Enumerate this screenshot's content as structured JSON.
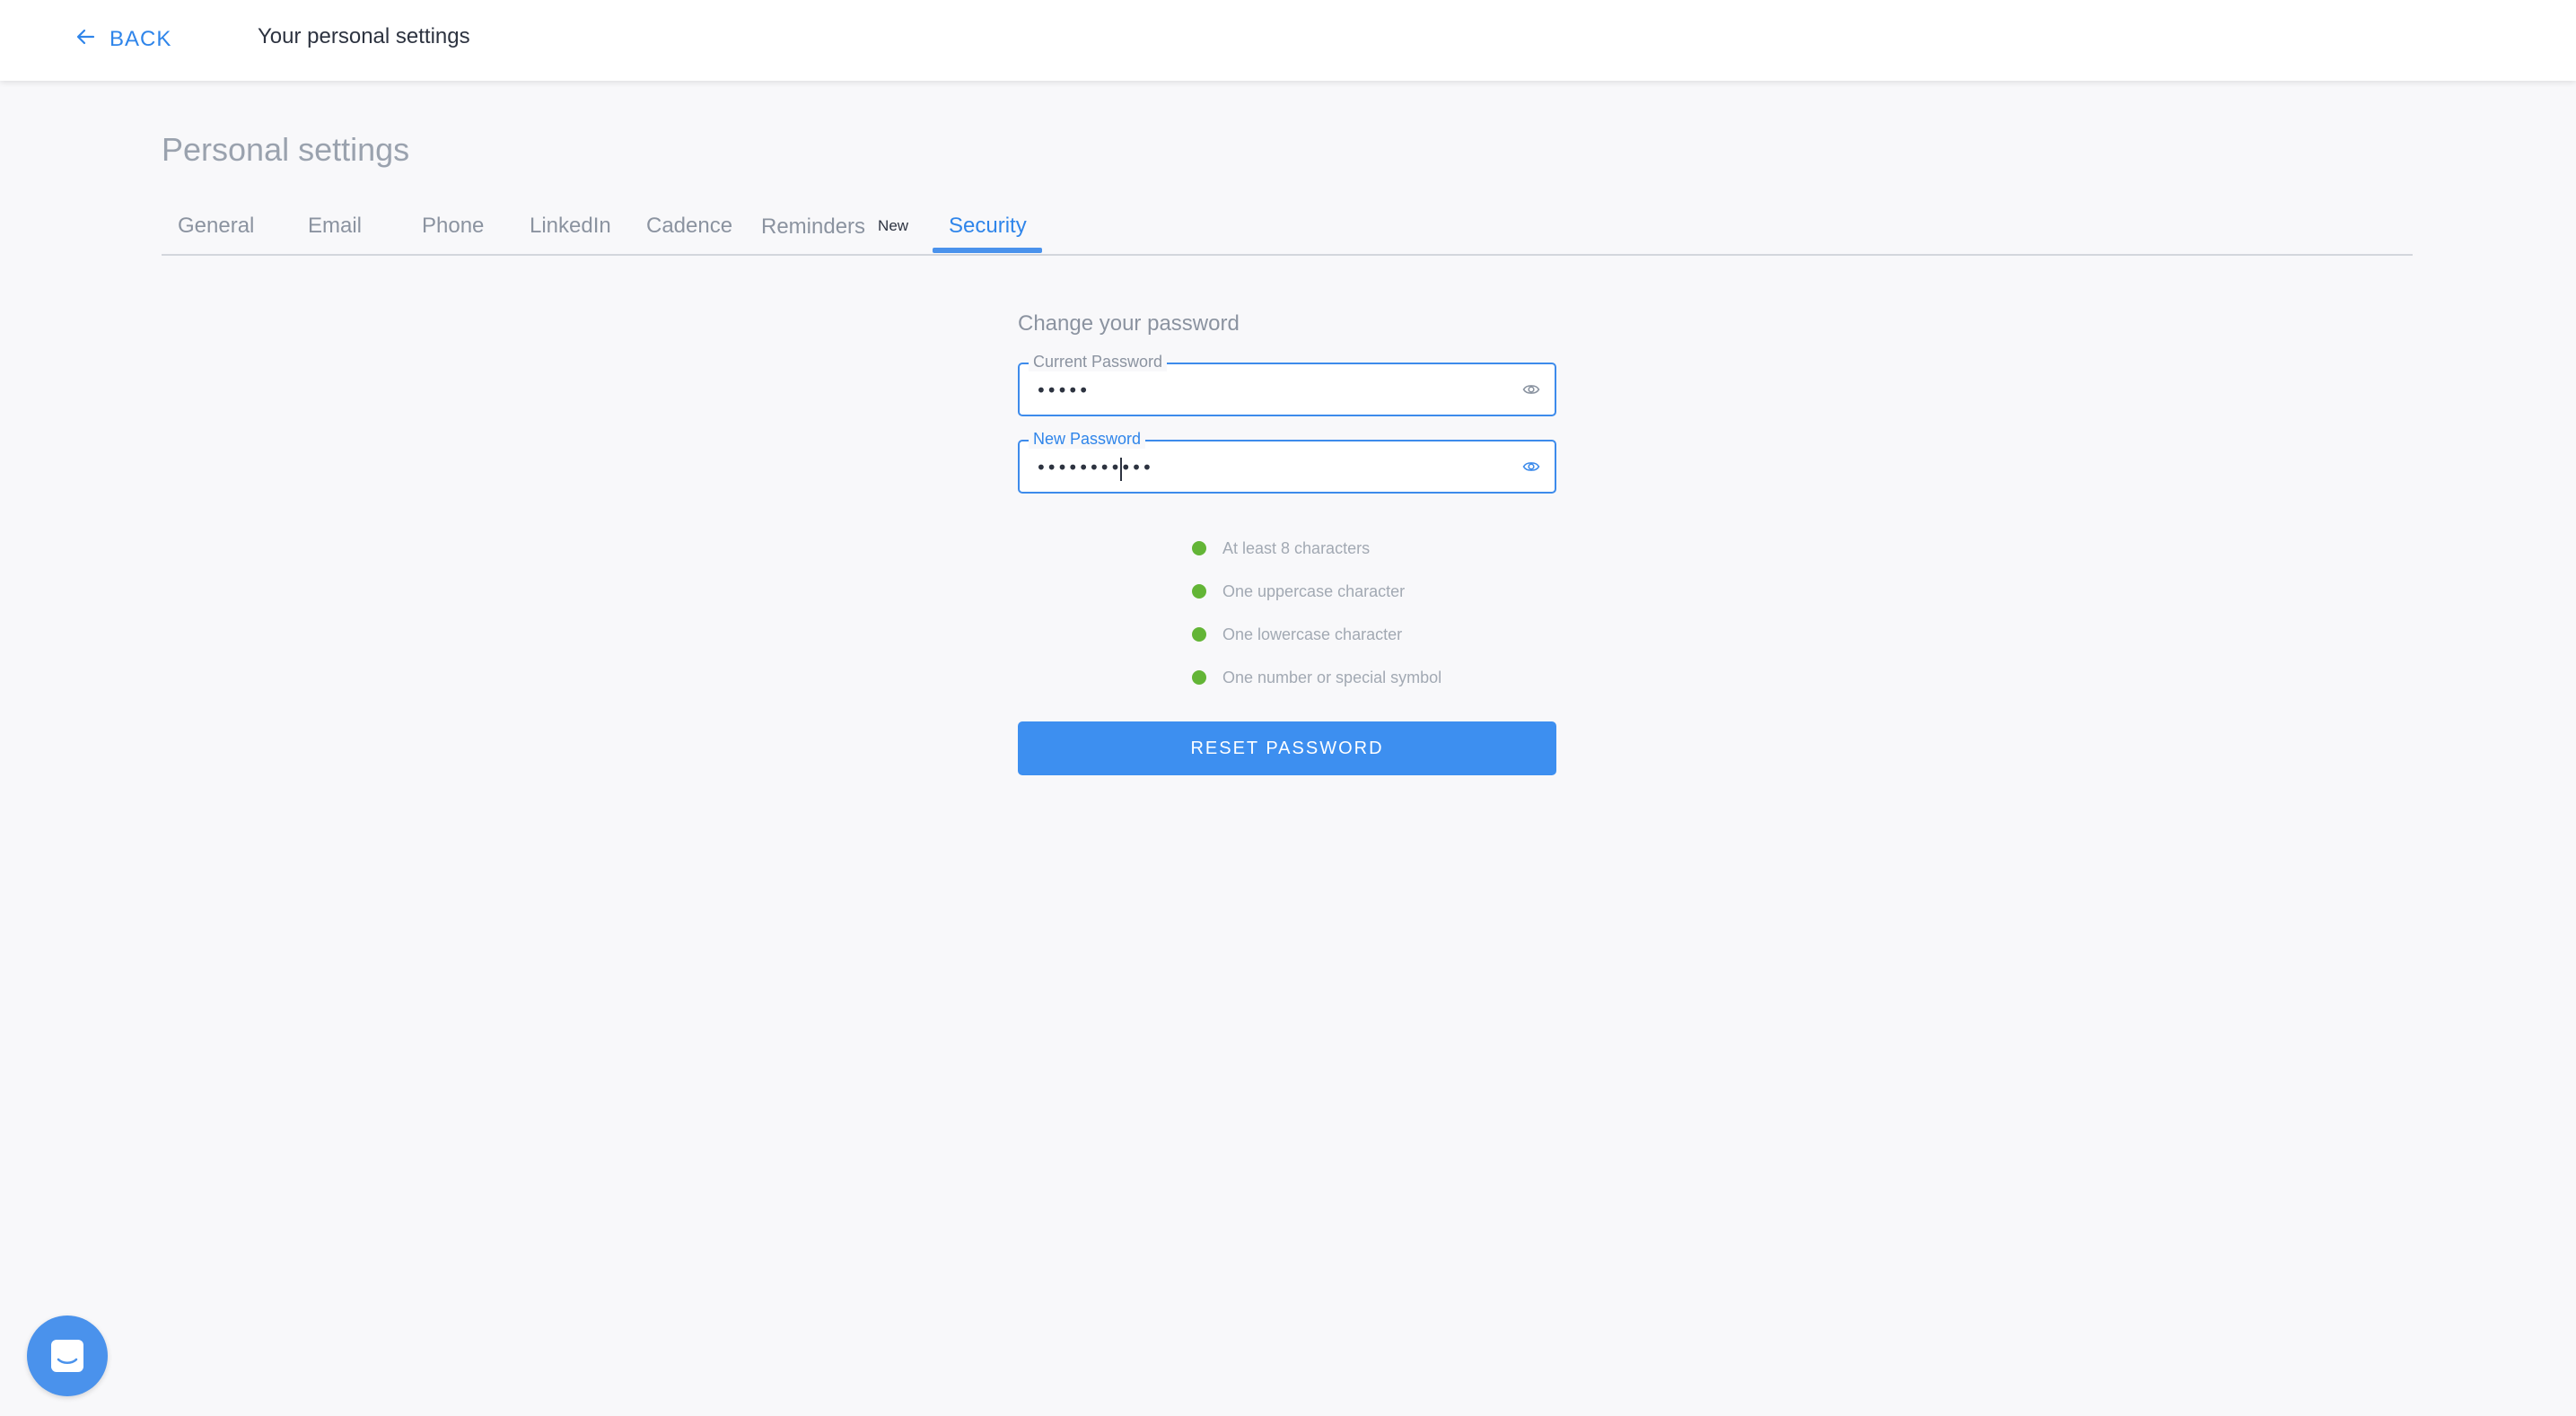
{
  "header": {
    "back_label": "BACK",
    "title": "Your personal settings"
  },
  "page": {
    "title": "Personal settings"
  },
  "tabs": [
    {
      "label": "General"
    },
    {
      "label": "Email"
    },
    {
      "label": "Phone"
    },
    {
      "label": "LinkedIn"
    },
    {
      "label": "Cadence"
    },
    {
      "label": "Reminders",
      "badge": "New"
    },
    {
      "label": "Security",
      "active": true
    }
  ],
  "form": {
    "title": "Change your password",
    "current_password": {
      "label": "Current Password",
      "value": "•••••"
    },
    "new_password": {
      "label": "New Password",
      "value": "•••••••••••"
    },
    "requirements": [
      {
        "text": "At least 8 characters",
        "met": true
      },
      {
        "text": "One uppercase character",
        "met": true
      },
      {
        "text": "One lowercase character",
        "met": true
      },
      {
        "text": "One number or special symbol",
        "met": true
      }
    ],
    "submit_label": "RESET PASSWORD"
  },
  "icons": {
    "back": "arrow-left-icon",
    "visibility": "eye-icon",
    "chat": "chat-bubble-icon"
  },
  "colors": {
    "accent": "#2f85ea",
    "button": "#3d8ff0",
    "success": "#63b536"
  }
}
